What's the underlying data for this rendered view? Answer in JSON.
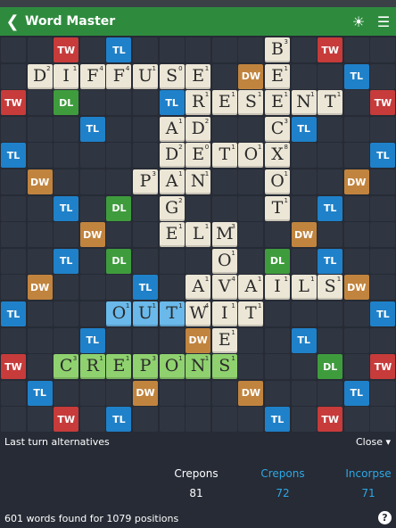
{
  "app": {
    "title": "Word Master"
  },
  "colors": {
    "header": "#2e8b3e",
    "TW": "#c73b3b",
    "DW": "#c1843e",
    "TL": "#1f81c9",
    "DL": "#3f9c3d",
    "tile": "#ece6d6",
    "tile_blue": "#6ab9ea",
    "tile_green": "#8fd16f"
  },
  "board": {
    "premiums": [
      [
        0,
        2,
        "TW"
      ],
      [
        0,
        4,
        "TL"
      ],
      [
        0,
        12,
        "TW"
      ],
      [
        1,
        9,
        "DW"
      ],
      [
        1,
        13,
        "TL"
      ],
      [
        2,
        0,
        "TW"
      ],
      [
        2,
        2,
        "DL"
      ],
      [
        2,
        6,
        "TL"
      ],
      [
        2,
        14,
        "TW"
      ],
      [
        3,
        3,
        "TL"
      ],
      [
        3,
        7,
        "DW"
      ],
      [
        3,
        11,
        "TL"
      ],
      [
        4,
        0,
        "TL"
      ],
      [
        4,
        14,
        "TL"
      ],
      [
        5,
        1,
        "DW"
      ],
      [
        5,
        13,
        "DW"
      ],
      [
        6,
        2,
        "TL"
      ],
      [
        6,
        4,
        "DL"
      ],
      [
        6,
        10,
        "DL"
      ],
      [
        6,
        12,
        "TL"
      ],
      [
        7,
        3,
        "DW"
      ],
      [
        7,
        11,
        "DW"
      ],
      [
        8,
        2,
        "TL"
      ],
      [
        8,
        4,
        "DL"
      ],
      [
        8,
        10,
        "DL"
      ],
      [
        8,
        12,
        "TL"
      ],
      [
        9,
        1,
        "DW"
      ],
      [
        9,
        5,
        "TL"
      ],
      [
        9,
        13,
        "DW"
      ],
      [
        10,
        0,
        "TL"
      ],
      [
        10,
        14,
        "TL"
      ],
      [
        11,
        3,
        "TL"
      ],
      [
        11,
        7,
        "DW"
      ],
      [
        11,
        11,
        "TL"
      ],
      [
        12,
        0,
        "TW"
      ],
      [
        12,
        12,
        "DL"
      ],
      [
        12,
        14,
        "TW"
      ],
      [
        13,
        1,
        "TL"
      ],
      [
        13,
        5,
        "DW"
      ],
      [
        13,
        9,
        "DW"
      ],
      [
        13,
        13,
        "TL"
      ],
      [
        14,
        2,
        "TW"
      ],
      [
        14,
        4,
        "TL"
      ],
      [
        14,
        10,
        "TL"
      ],
      [
        14,
        12,
        "TW"
      ]
    ],
    "tiles": [
      [
        0,
        10,
        "B",
        "3",
        ""
      ],
      [
        1,
        1,
        "D",
        "2",
        ""
      ],
      [
        1,
        2,
        "I",
        "1",
        ""
      ],
      [
        1,
        3,
        "F",
        "4",
        ""
      ],
      [
        1,
        4,
        "F",
        "4",
        ""
      ],
      [
        1,
        5,
        "U",
        "1",
        ""
      ],
      [
        1,
        6,
        "S",
        "0",
        ""
      ],
      [
        1,
        7,
        "E",
        "1",
        ""
      ],
      [
        1,
        10,
        "E",
        "1",
        ""
      ],
      [
        2,
        7,
        "R",
        "1",
        ""
      ],
      [
        2,
        8,
        "E",
        "1",
        ""
      ],
      [
        2,
        9,
        "S",
        "1",
        ""
      ],
      [
        2,
        10,
        "E",
        "1",
        ""
      ],
      [
        2,
        11,
        "N",
        "1",
        ""
      ],
      [
        2,
        12,
        "T",
        "1",
        ""
      ],
      [
        3,
        6,
        "A",
        "1",
        ""
      ],
      [
        3,
        7,
        "D",
        "2",
        ""
      ],
      [
        3,
        10,
        "C",
        "3",
        ""
      ],
      [
        4,
        6,
        "D",
        "2",
        ""
      ],
      [
        4,
        7,
        "E",
        "0",
        ""
      ],
      [
        4,
        8,
        "T",
        "1",
        ""
      ],
      [
        4,
        9,
        "O",
        "1",
        ""
      ],
      [
        4,
        10,
        "X",
        "8",
        ""
      ],
      [
        5,
        5,
        "P",
        "3",
        ""
      ],
      [
        5,
        6,
        "A",
        "1",
        ""
      ],
      [
        5,
        7,
        "N",
        "1",
        ""
      ],
      [
        5,
        10,
        "O",
        "1",
        ""
      ],
      [
        6,
        6,
        "G",
        "2",
        ""
      ],
      [
        6,
        10,
        "T",
        "1",
        ""
      ],
      [
        7,
        6,
        "E",
        "1",
        ""
      ],
      [
        7,
        7,
        "L",
        "1",
        ""
      ],
      [
        7,
        8,
        "M",
        "3",
        ""
      ],
      [
        8,
        8,
        "O",
        "1",
        ""
      ],
      [
        9,
        7,
        "A",
        "1",
        ""
      ],
      [
        9,
        8,
        "V",
        "4",
        ""
      ],
      [
        9,
        9,
        "A",
        "1",
        ""
      ],
      [
        9,
        10,
        "I",
        "1",
        ""
      ],
      [
        9,
        11,
        "L",
        "1",
        ""
      ],
      [
        9,
        12,
        "S",
        "1",
        ""
      ],
      [
        10,
        4,
        "O",
        "1",
        "b"
      ],
      [
        10,
        5,
        "U",
        "1",
        "b"
      ],
      [
        10,
        6,
        "T",
        "1",
        "b"
      ],
      [
        10,
        7,
        "W",
        "4",
        ""
      ],
      [
        10,
        8,
        "I",
        "1",
        ""
      ],
      [
        10,
        9,
        "T",
        "1",
        ""
      ],
      [
        11,
        8,
        "E",
        "1",
        ""
      ],
      [
        12,
        2,
        "C",
        "3",
        "g"
      ],
      [
        12,
        3,
        "R",
        "1",
        "g"
      ],
      [
        12,
        4,
        "E",
        "1",
        "g"
      ],
      [
        12,
        5,
        "P",
        "3",
        "g"
      ],
      [
        12,
        6,
        "O",
        "1",
        "g"
      ],
      [
        12,
        7,
        "N",
        "1",
        "g"
      ],
      [
        12,
        8,
        "S",
        "1",
        "g"
      ]
    ]
  },
  "alternatives": {
    "label": "Last turn alternatives",
    "close_label": "Close",
    "columns": [
      {
        "word": "Crepons",
        "score": "81",
        "color": "#ffffff"
      },
      {
        "word": "Crepons",
        "score": "72",
        "color": "#2ea8e5"
      },
      {
        "word": "Incorpse",
        "score": "71",
        "color": "#2ea8e5"
      }
    ]
  },
  "footer": {
    "status": "601 words found for 1079 positions",
    "help": "?"
  }
}
